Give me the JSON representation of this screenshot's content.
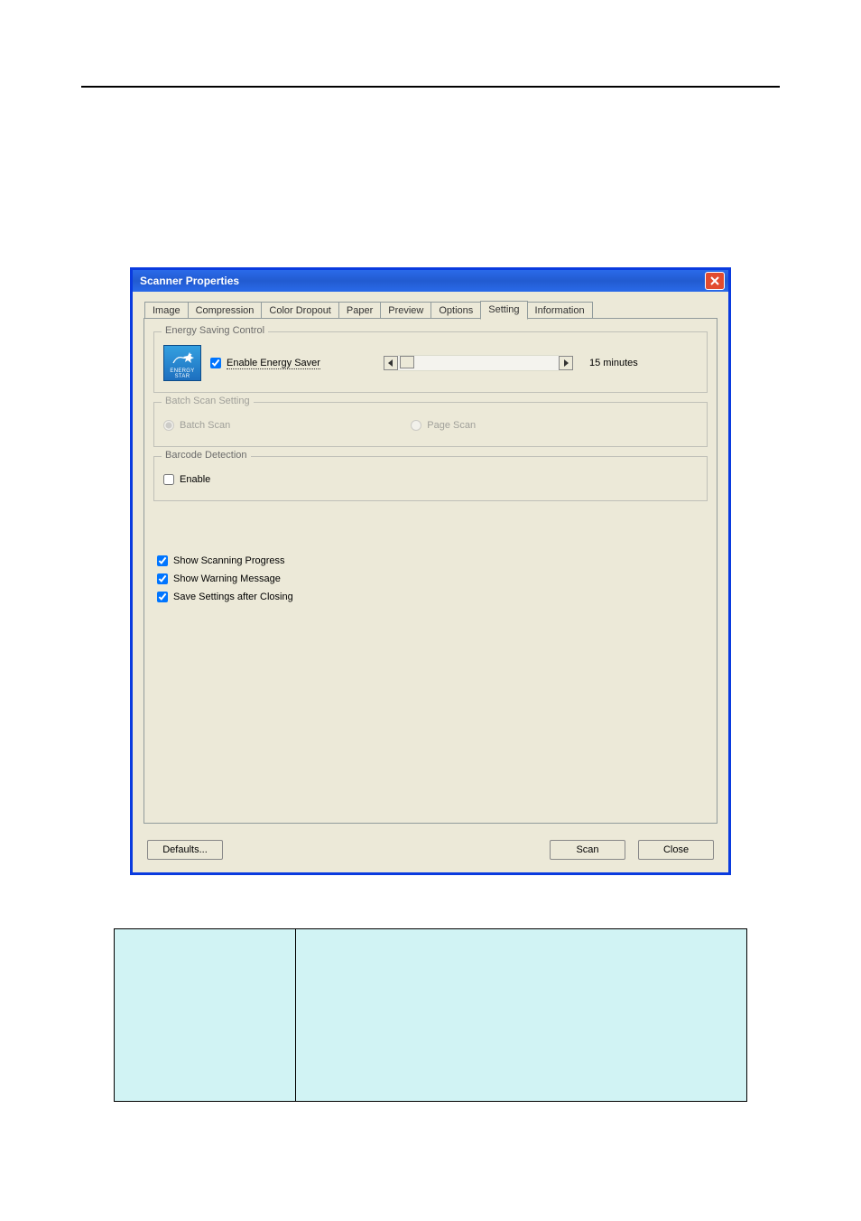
{
  "dialog": {
    "title": "Scanner Properties",
    "tabs": [
      "Image",
      "Compression",
      "Color Dropout",
      "Paper",
      "Preview",
      "Options",
      "Setting",
      "Information"
    ],
    "active_tab": "Setting",
    "energy_group_title": "Energy Saving Control",
    "energy_logo_text": "ENERGY STAR",
    "energy_checkbox_label": "Enable Energy Saver",
    "energy_checkbox_checked": true,
    "energy_slider_value_label": "15 minutes",
    "batch_group_title": "Batch Scan Setting",
    "batch_radio_label": "Batch Scan",
    "page_radio_label": "Page Scan",
    "batch_selected": true,
    "barcode_group_title": "Barcode Detection",
    "barcode_checkbox_label": "Enable",
    "barcode_checkbox_checked": false,
    "show_progress_label": "Show Scanning Progress",
    "show_progress_checked": true,
    "show_warning_label": "Show Warning Message",
    "show_warning_checked": true,
    "save_settings_label": "Save Settings after Closing",
    "save_settings_checked": true,
    "defaults_button": "Defaults...",
    "scan_button": "Scan",
    "close_button": "Close"
  }
}
